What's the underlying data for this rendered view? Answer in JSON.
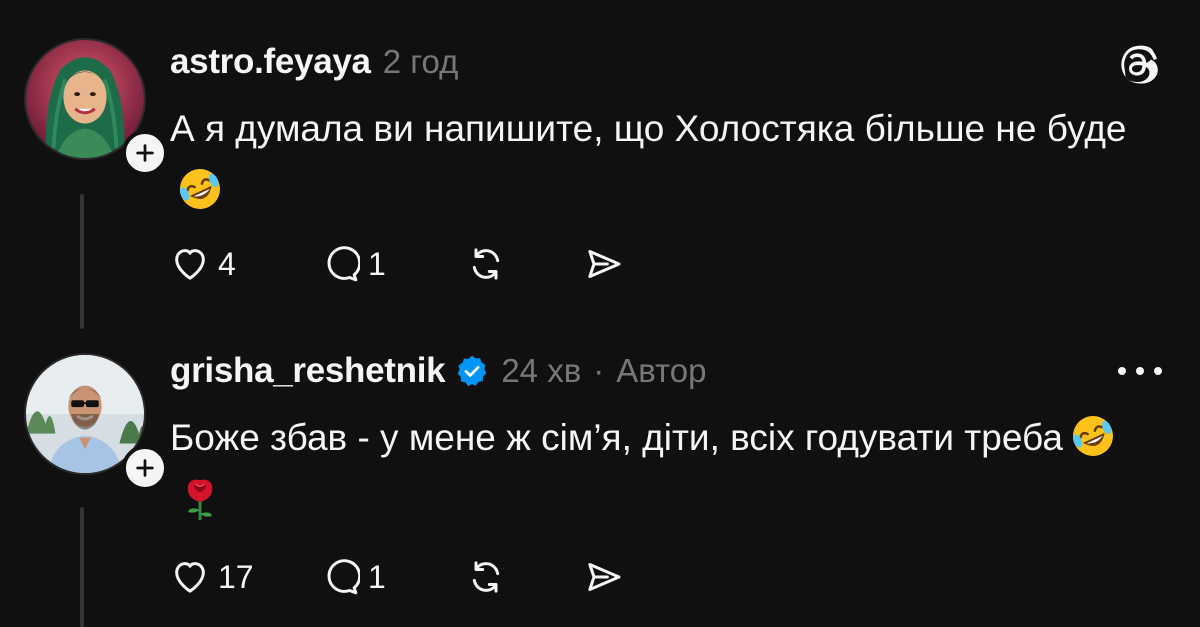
{
  "posts": [
    {
      "username": "astro.feyaya",
      "time": "2 год",
      "text": "А я думала ви напишите, що Холостяка більше не буде",
      "emojis": [
        "rolling-on-floor-laughing"
      ],
      "likes": "4",
      "replies": "1",
      "verified": false,
      "author_tag": ""
    },
    {
      "username": "grisha_reshetnik",
      "time": "24 хв",
      "separator": "·",
      "author_tag": "Автор",
      "text": "Боже збав - у мене ж сім’я, діти, всіх годувати треба",
      "emojis": [
        "rolling-on-floor-laughing",
        "rose"
      ],
      "likes": "17",
      "replies": "1",
      "verified": true
    }
  ],
  "icons": {
    "header_right_post_1": "threads-logo-icon",
    "header_right_post_2": "more-icon",
    "actions": [
      "heart-icon",
      "comment-icon",
      "repost-icon",
      "share-icon"
    ],
    "follow": "plus-icon",
    "verified": "verified-badge-icon"
  },
  "colors": {
    "background": "#101010",
    "text": "#f3f5f7",
    "meta": "#777777",
    "verified": "#0095f6",
    "thread_line": "#333638"
  }
}
